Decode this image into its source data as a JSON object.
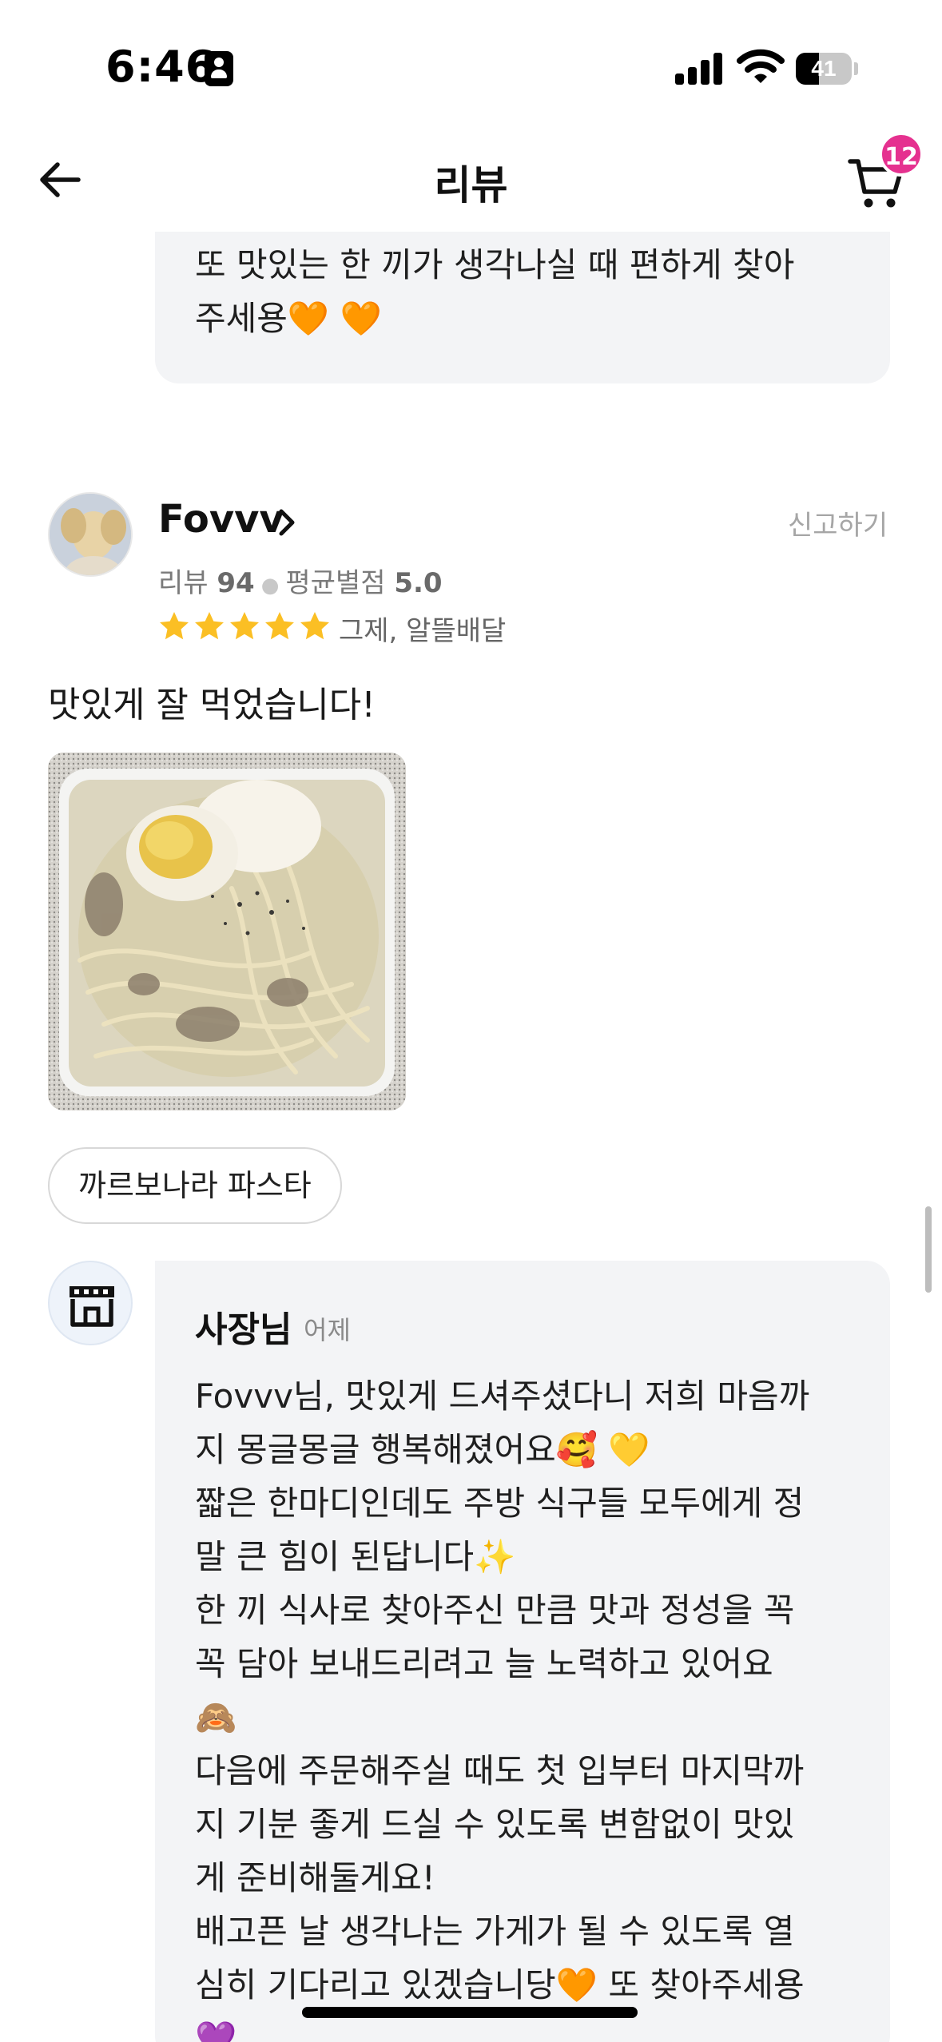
{
  "status_bar": {
    "time": "6:46",
    "battery_level": "41",
    "battery_fraction": 0.41
  },
  "header": {
    "title": "리뷰",
    "back_icon": "arrow-left-icon",
    "cart_icon": "cart-icon",
    "cart_count": "12"
  },
  "previous_reply": {
    "text": "또 맛있는 한 끼가 생각나실 때 편하게 찾아\n주세용🧡 🧡"
  },
  "review": {
    "nickname": "Fovvv",
    "report_label": "신고하기",
    "review_count_label": "리뷰",
    "review_count": "94",
    "avg_rating_label": "평균별점",
    "avg_rating": "5.0",
    "rating": 5,
    "star_color": "#fbbf24",
    "order_meta": "그제, 알뜰배달",
    "text": "맛있게 잘 먹었습니다!",
    "menu_item": "까르보나라 파스타"
  },
  "owner_reply": {
    "name": "사장님",
    "date": "어제",
    "icon": "store-icon",
    "text": "Fovvv님, 맛있게 드셔주셨다니 저희 마음까\n지 몽글몽글 행복해졌어요🥰 💛\n짧은 한마디인데도 주방 식구들 모두에게 정\n말 큰 힘이 된답니다✨\n한 끼 식사로 찾아주신 만큼 맛과 정성을 꼭\n꼭 담아 보내드리려고 늘 노력하고 있어요\n🙈\n다음에 주문해주실 때도 첫 입부터 마지막까\n지 기분 좋게 드실 수 있도록 변함없이 맛있\n게 준비해둘게요!\n배고픈 날 생각나는 가게가 될 수 있도록 열\n심히 기다리고 있겠습니당🧡 또 찾아주세용\n💜"
  },
  "colors": {
    "accent_badge": "#e5318f",
    "bubble_bg": "#f3f4f6",
    "muted_text": "#a6a6a6"
  }
}
